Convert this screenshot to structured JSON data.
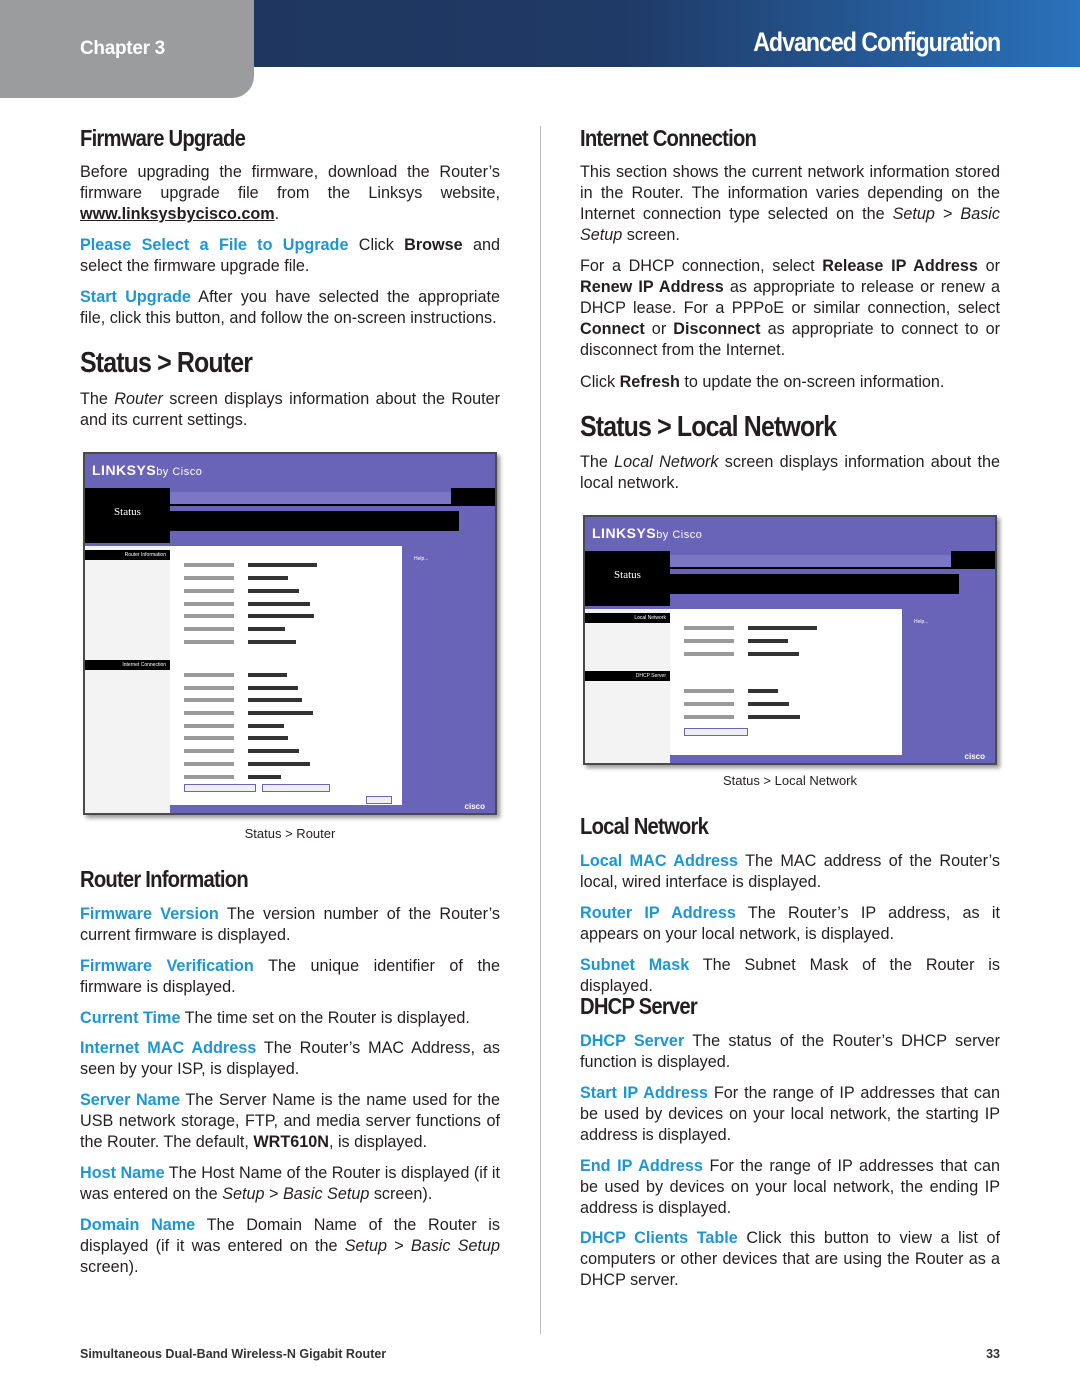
{
  "header": {
    "chapter": "Chapter 3",
    "section": "Advanced Configuration"
  },
  "left": {
    "firmware_upgrade": {
      "title": "Firmware Upgrade",
      "paras": [
        [
          {
            "t": "Before upgrading the firmware, download the Router’s firmware upgrade file from the Linksys website, "
          },
          {
            "t": "www.linksysbycisco.com",
            "s": "u"
          },
          {
            "t": "."
          }
        ],
        [
          {
            "t": "Please Select a File to Upgrade",
            "s": "term"
          },
          {
            "t": "  Click "
          },
          {
            "t": "Browse",
            "s": "b"
          },
          {
            "t": " and select the firmware upgrade file."
          }
        ],
        [
          {
            "t": "Start Upgrade",
            "s": "term"
          },
          {
            "t": "  After you have selected the appropriate file, click this button, and follow the on-screen instructions."
          }
        ]
      ]
    },
    "status_router": {
      "title": "Status > Router",
      "paras": [
        [
          {
            "t": "The "
          },
          {
            "t": "Router",
            "s": "i"
          },
          {
            "t": " screen displays information about the Router and its current settings."
          }
        ]
      ],
      "caption": "Status > Router"
    },
    "router_information": {
      "title": "Router Information",
      "paras": [
        [
          {
            "t": "Firmware Version",
            "s": "term"
          },
          {
            "t": "  The version number of the Router’s current firmware is displayed."
          }
        ],
        [
          {
            "t": "Firmware Verification",
            "s": "term"
          },
          {
            "t": "  The unique identifier of the firmware is displayed."
          }
        ],
        [
          {
            "t": "Current Time",
            "s": "term"
          },
          {
            "t": "  The time set on the Router is displayed."
          }
        ],
        [
          {
            "t": "Internet MAC Address",
            "s": "term"
          },
          {
            "t": "  The Router’s MAC Address, as seen by your ISP, is displayed."
          }
        ],
        [
          {
            "t": "Server Name",
            "s": "term"
          },
          {
            "t": "  The Server Name is the name used for the USB network storage, FTP, and media server functions of the Router. The default, "
          },
          {
            "t": "WRT610N",
            "s": "b"
          },
          {
            "t": ", is displayed."
          }
        ],
        [
          {
            "t": "Host Name",
            "s": "term"
          },
          {
            "t": "  The Host Name of the Router is displayed (if it was entered on the "
          },
          {
            "t": "Setup",
            "s": "i"
          },
          {
            "t": " > "
          },
          {
            "t": "Basic Setup",
            "s": "i"
          },
          {
            "t": " screen)."
          }
        ],
        [
          {
            "t": "Domain Name",
            "s": "term"
          },
          {
            "t": "  The Domain Name of the Router is displayed (if it was entered on the "
          },
          {
            "t": "Setup",
            "s": "i"
          },
          {
            "t": " > "
          },
          {
            "t": "Basic Setup",
            "s": "i"
          },
          {
            "t": " screen)."
          }
        ]
      ]
    }
  },
  "right": {
    "internet_connection": {
      "title": "Internet Connection",
      "paras": [
        [
          {
            "t": "This section shows the current network information stored in the Router. The information varies depending on the Internet connection type selected on the "
          },
          {
            "t": "Setup",
            "s": "i"
          },
          {
            "t": " > "
          },
          {
            "t": "Basic Setup",
            "s": "i"
          },
          {
            "t": " screen."
          }
        ],
        [
          {
            "t": "For a DHCP connection, select "
          },
          {
            "t": "Release IP Address",
            "s": "b"
          },
          {
            "t": " or "
          },
          {
            "t": "Renew IP Address",
            "s": "b"
          },
          {
            "t": " as appropriate to release or renew a DHCP lease. For a PPPoE or similar connection, select "
          },
          {
            "t": "Connect",
            "s": "b"
          },
          {
            "t": " or "
          },
          {
            "t": "Disconnect",
            "s": "b"
          },
          {
            "t": " as appropriate to connect to or disconnect from the Internet."
          }
        ],
        [
          {
            "t": "Click "
          },
          {
            "t": "Refresh",
            "s": "b"
          },
          {
            "t": " to update the on-screen information."
          }
        ]
      ]
    },
    "status_local": {
      "title": "Status > Local Network",
      "paras": [
        [
          {
            "t": "The "
          },
          {
            "t": "Local Network",
            "s": "i"
          },
          {
            "t": " screen displays information about the local network."
          }
        ]
      ],
      "caption": "Status > Local Network"
    },
    "local_network": {
      "title": "Local Network",
      "paras": [
        [
          {
            "t": "Local MAC Address",
            "s": "term"
          },
          {
            "t": "  The MAC address of the Router’s local, wired interface is displayed."
          }
        ],
        [
          {
            "t": "Router IP Address",
            "s": "term"
          },
          {
            "t": "  The Router’s IP address, as it appears on your local network, is displayed."
          }
        ],
        [
          {
            "t": "Subnet Mask",
            "s": "term"
          },
          {
            "t": "  The Subnet Mask of the Router is displayed."
          }
        ]
      ]
    },
    "dhcp_server": {
      "title": "DHCP Server",
      "paras": [
        [
          {
            "t": "DHCP Server",
            "s": "term"
          },
          {
            "t": "  The status of the Router’s DHCP server function is displayed."
          }
        ],
        [
          {
            "t": "Start IP Address",
            "s": "term"
          },
          {
            "t": "  For the range of IP addresses that can be used by devices on your local network, the starting IP address is displayed."
          }
        ],
        [
          {
            "t": "End IP Address",
            "s": "term"
          },
          {
            "t": "  For the range of IP addresses that can be used by devices on your local network, the ending IP address is displayed."
          }
        ],
        [
          {
            "t": "DHCP Clients Table",
            "s": "term"
          },
          {
            "t": "  Click this button to view a list of computers or other devices that are using the Router as a DHCP server."
          }
        ]
      ]
    }
  },
  "screens": {
    "logo": "LINKSYS",
    "logo_by": "by Cisco",
    "page_title": "Status",
    "cisco": "cisco",
    "router": {
      "side": [
        "Router Information",
        "Internet Connection"
      ]
    },
    "local": {
      "side": [
        "Local Network",
        "DHCP Server"
      ]
    }
  },
  "footer": {
    "product": "Simultaneous Dual-Band Wireless-N Gigabit Router",
    "page": "33"
  },
  "colors": {
    "term": "#1d96d3",
    "header_bar": "#1f3760",
    "chapter_tab": "#9b9c9e"
  }
}
